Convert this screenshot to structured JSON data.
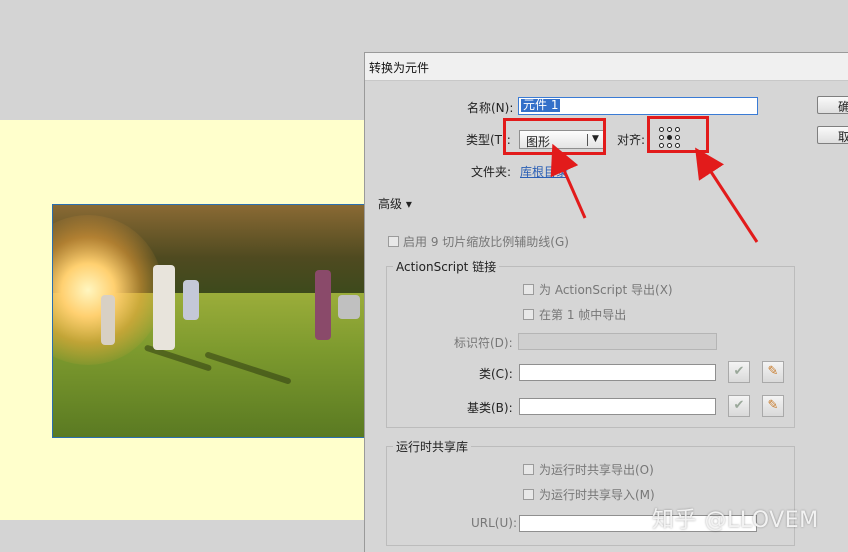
{
  "dialog": {
    "title": "转换为元件",
    "name_label": "名称(N):",
    "name_value": "元件 1",
    "type_label": "类型(T):",
    "type_value": "图形",
    "align_label": "对齐:",
    "folder_label": "文件夹:",
    "folder_value": "库根目录",
    "ok_label": "确定",
    "cancel_label": "取消",
    "advanced_label": "高级 ▾",
    "enable_9slice_label": "启用 9 切片缩放比例辅助线(G)",
    "actionscript_group": {
      "title": "ActionScript 链接",
      "export_as_label": "为 ActionScript 导出(X)",
      "export_frame1_label": "在第 1 帧中导出",
      "identifier_label": "标识符(D):",
      "class_label": "类(C):",
      "base_class_label": "基类(B):"
    },
    "runtime_group": {
      "title": "运行时共享库",
      "export_runtime_label": "为运行时共享导出(O)",
      "import_runtime_label": "为运行时共享导入(M)",
      "url_label": "URL(U):"
    }
  },
  "icons": {
    "check": "✔",
    "pencil": "✎",
    "dropdown": "▼"
  },
  "watermark": "知乎 @LLOVEM",
  "colors": {
    "stage": "#ffffcc",
    "dialog": "#d6d6d6",
    "selection": "#3470c9",
    "link": "#2a5fb5",
    "highlight_red": "#e21b1b"
  }
}
